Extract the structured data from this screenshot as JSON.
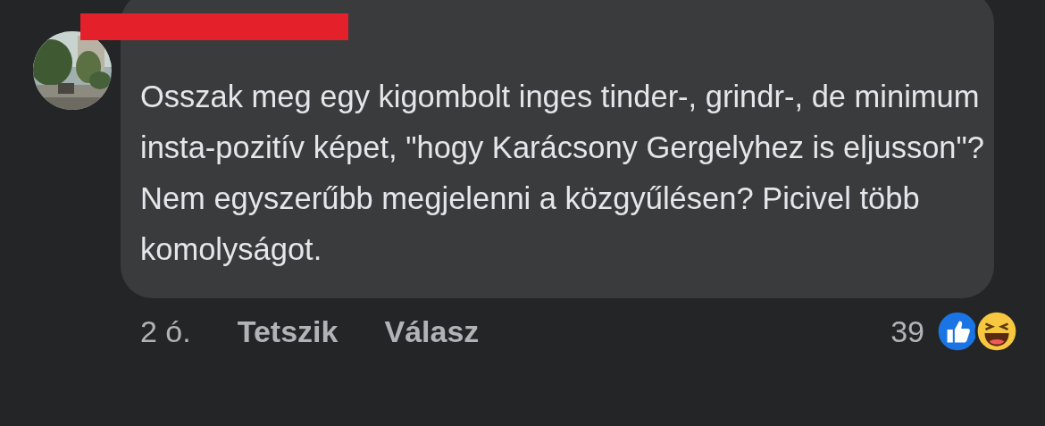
{
  "comment": {
    "text": "Osszak meg egy kigombolt inges tinder-, grindr-, de minimum insta-pozitív képet, \"hogy Karácsony Gergelyhez is eljusson\"? Nem egyszerűbb megjelenni a közgyűlésen? Picivel több komolyságot.",
    "time": "2 ó.",
    "like_label": "Tetszik",
    "reply_label": "Válasz",
    "reaction_count": "39"
  }
}
